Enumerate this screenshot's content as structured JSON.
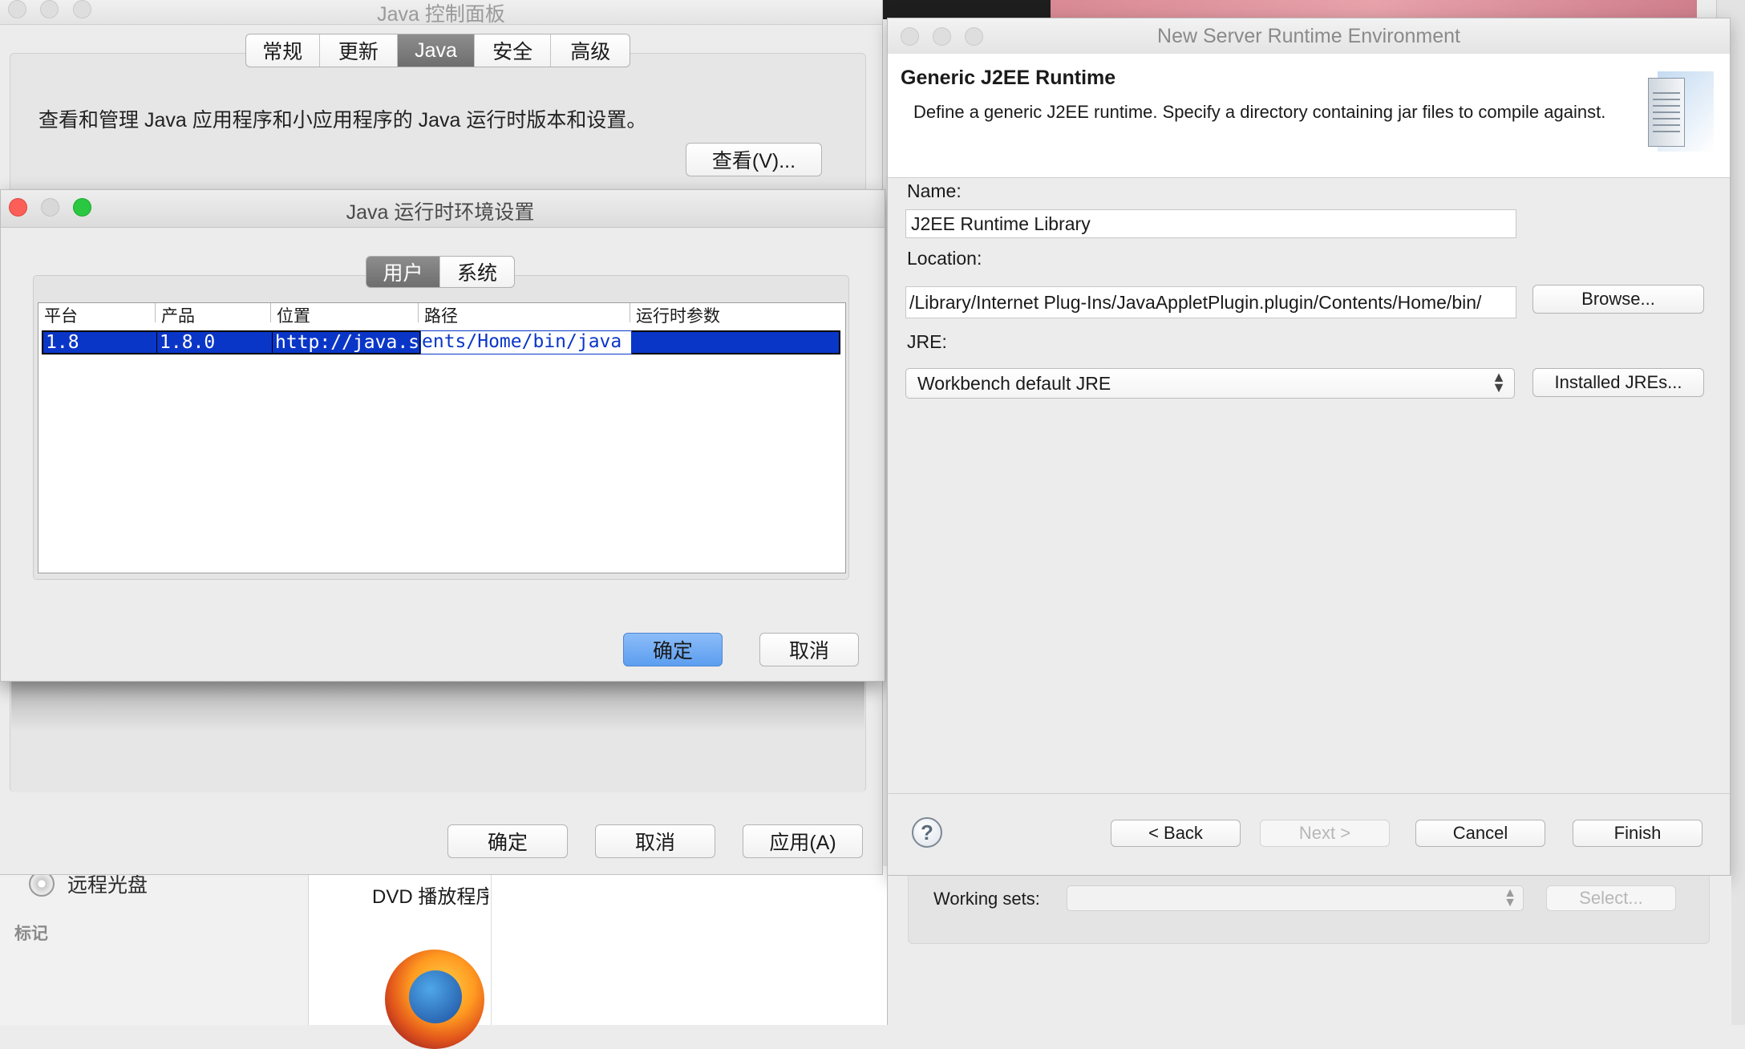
{
  "control_panel": {
    "title": "Java 控制面板",
    "tabs": [
      {
        "label": "常规"
      },
      {
        "label": "更新"
      },
      {
        "label": "Java"
      },
      {
        "label": "安全"
      },
      {
        "label": "高级"
      }
    ],
    "description": "查看和管理 Java 应用程序和小应用程序的 Java 运行时版本和设置。",
    "view_button": "查看(V)...",
    "ok_button": "确定",
    "cancel_button": "取消",
    "apply_button": "应用(A)"
  },
  "runtime_dialog": {
    "title": "Java 运行时环境设置",
    "tabs": [
      {
        "label": "用户"
      },
      {
        "label": "系统"
      }
    ],
    "columns": [
      "平台",
      "产品",
      "位置",
      "路径",
      "运行时参数"
    ],
    "row": {
      "platform": "1.8",
      "product": "1.8.0",
      "location": "http://java.s...",
      "path": "ents/Home/bin/java",
      "args": ""
    },
    "ok_button": "确定",
    "cancel_button": "取消"
  },
  "background": {
    "sidebar_item": "远程光盘",
    "sidebar_heading": "标记",
    "app_label": "DVD 播放程序"
  },
  "eclipse": {
    "title": "New Server Runtime Environment",
    "heading": "Generic J2EE Runtime",
    "description": "Define a generic J2EE runtime. Specify a directory containing jar files to compile against.",
    "name_label": "Name:",
    "name_value": "J2EE Runtime Library",
    "location_label": "Location:",
    "location_value": "/Library/Internet Plug-Ins/JavaAppletPlugin.plugin/Contents/Home/bin/",
    "browse_button": "Browse...",
    "jre_label": "JRE:",
    "jre_value": "Workbench default JRE",
    "installed_jres_button": "Installed JREs...",
    "help_icon_glyph": "?",
    "back_button": "< Back",
    "next_button": "Next >",
    "cancel_button": "Cancel",
    "finish_button": "Finish",
    "working_sets_label": "Working sets:",
    "select_button": "Select..."
  },
  "colors": {
    "selection_blue": "#0a36c8",
    "primary_button": "#6aa8f4",
    "window_bg": "#ececec"
  }
}
